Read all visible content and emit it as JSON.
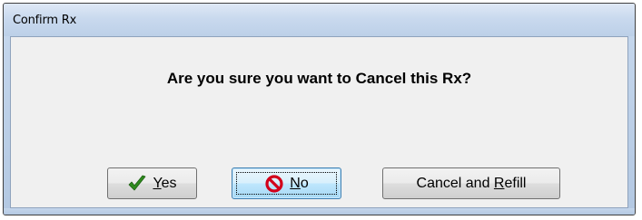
{
  "window": {
    "title": "Confirm Rx"
  },
  "dialog": {
    "message": "Are you sure you want to Cancel this Rx?"
  },
  "buttons": {
    "yes": {
      "mnemonic": "Y",
      "rest": "es",
      "icon": "checkmark-icon",
      "color": "#2e8b1e"
    },
    "no": {
      "mnemonic": "N",
      "rest": "o",
      "icon": "prohibited-icon",
      "color": "#d2001a"
    },
    "refill": {
      "before": "Cancel and ",
      "mnemonic": "R",
      "rest": "efill"
    }
  },
  "colors": {
    "frame": "#bcd0e8",
    "client": "#f0f0f0",
    "focused_button_border": "#3c7fb1"
  }
}
